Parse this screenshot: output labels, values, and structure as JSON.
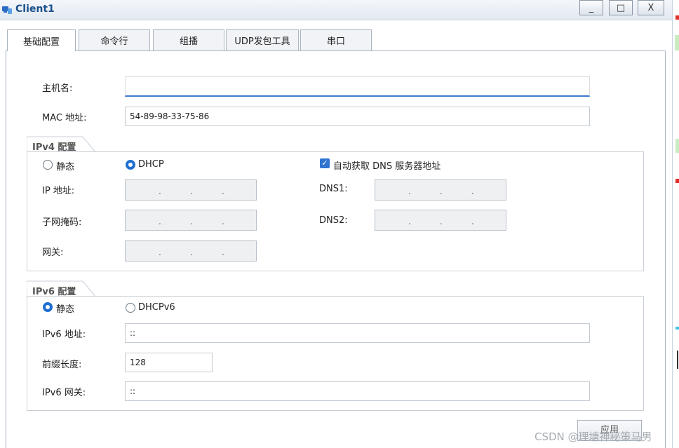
{
  "window": {
    "title": "Client1",
    "buttons": {
      "minimize": "_",
      "maximize": "□",
      "close": "X"
    }
  },
  "tabs": [
    {
      "label": "基础配置",
      "active": true
    },
    {
      "label": "命令行",
      "active": false
    },
    {
      "label": "组播",
      "active": false
    },
    {
      "label": "UDP发包工具",
      "active": false
    },
    {
      "label": "串口",
      "active": false
    }
  ],
  "form": {
    "hostname_label": "主机名:",
    "hostname_value": "",
    "mac_label": "MAC 地址:",
    "mac_value": "54-89-98-33-75-86"
  },
  "ipv4": {
    "group_title": "IPv4 配置",
    "static_label": "静态",
    "dhcp_label": "DHCP",
    "selected": "DHCP",
    "auto_dns_label": "自动获取 DNS 服务器地址",
    "auto_dns_checked": true,
    "ip_label": "IP 地址:",
    "mask_label": "子网掩码:",
    "gateway_label": "网关:",
    "dns1_label": "DNS1:",
    "dns2_label": "DNS2:"
  },
  "ipv6": {
    "group_title": "IPv6 配置",
    "static_label": "静态",
    "dhcpv6_label": "DHCPv6",
    "selected": "静态",
    "address_label": "IPv6 地址:",
    "address_value": "::",
    "prefix_label": "前缀长度:",
    "prefix_value": "128",
    "gateway_label": "IPv6 网关:",
    "gateway_value": "::"
  },
  "apply_label": "应用",
  "watermark": "CSDN @理塘神秘策马男",
  "colors": {
    "accent": "#1f6fd1",
    "title": "#1a4f8b"
  }
}
